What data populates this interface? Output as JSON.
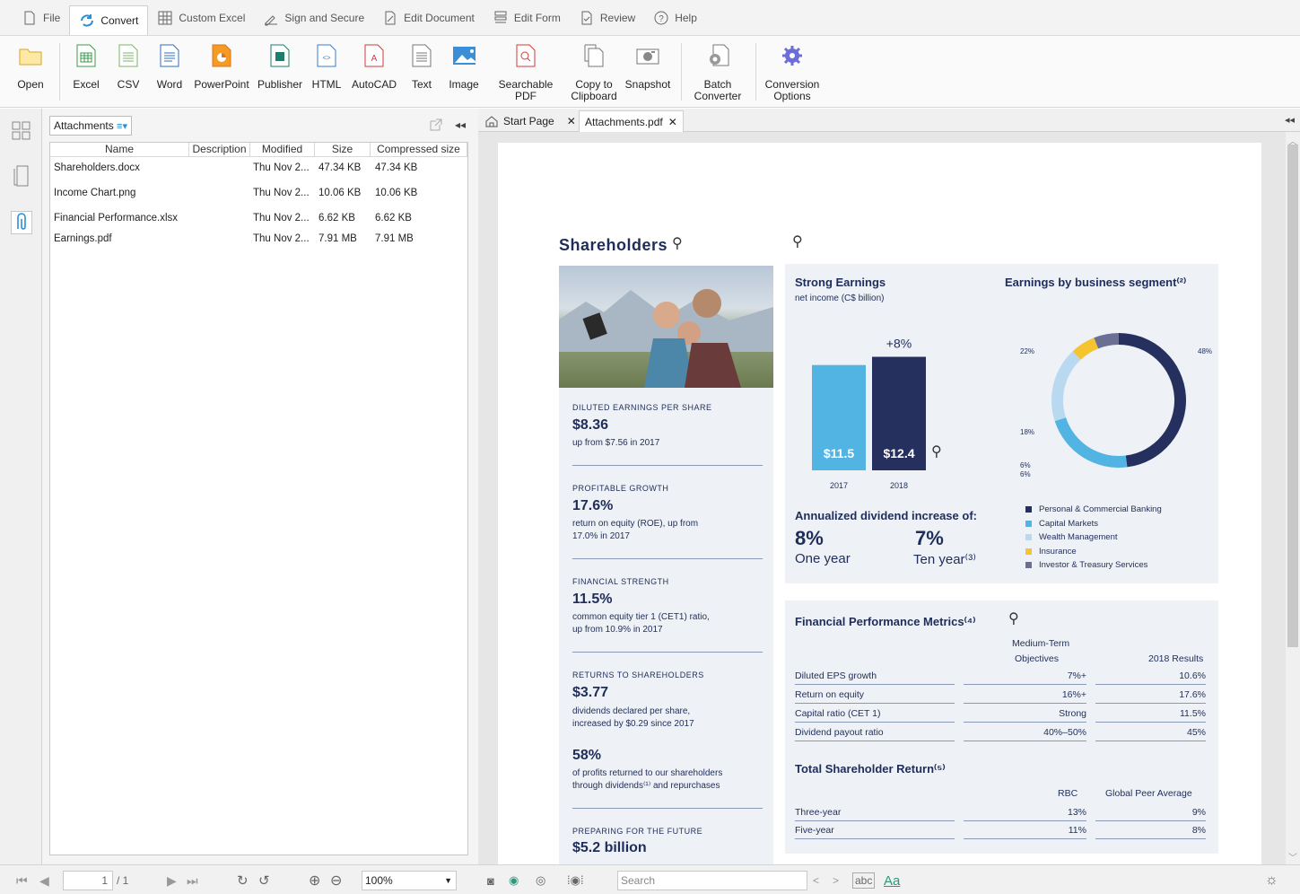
{
  "menubar": {
    "items": [
      {
        "label": "File",
        "icon": "file-icon"
      },
      {
        "label": "Convert",
        "icon": "convert-icon",
        "active": true
      },
      {
        "label": "Custom Excel",
        "icon": "table-icon"
      },
      {
        "label": "Sign and Secure",
        "icon": "sign-icon"
      },
      {
        "label": "Edit Document",
        "icon": "edit-icon"
      },
      {
        "label": "Edit Form",
        "icon": "form-icon"
      },
      {
        "label": "Review",
        "icon": "review-icon"
      },
      {
        "label": "Help",
        "icon": "help-icon"
      }
    ]
  },
  "ribbon": {
    "open": "Open",
    "excel": "Excel",
    "csv": "CSV",
    "word": "Word",
    "powerpoint": "PowerPoint",
    "publisher": "Publisher",
    "html": "HTML",
    "autocad": "AutoCAD",
    "text": "Text",
    "image": "Image",
    "searchable": "Searchable PDF",
    "copy1": "Copy to",
    "copy2": "Clipboard",
    "snapshot": "Snapshot",
    "batch1": "Batch",
    "batch2": "Converter",
    "conv1": "Conversion",
    "conv2": "Options"
  },
  "attachments": {
    "dropdown": "Attachments",
    "columns": [
      "Name",
      "Description",
      "Modified",
      "Size",
      "Compressed size"
    ],
    "rows": [
      {
        "name": "Shareholders.docx",
        "desc": "",
        "modified": "Thu Nov 2...",
        "size": "47.34 KB",
        "csize": "47.34 KB"
      },
      {
        "name": "Income Chart.png",
        "desc": "",
        "modified": "Thu Nov 2...",
        "size": "10.06 KB",
        "csize": "10.06 KB"
      },
      {
        "name": "Financial Performance.xlsx",
        "desc": "",
        "modified": "Thu Nov 2...",
        "size": "6.62 KB",
        "csize": "6.62 KB"
      },
      {
        "name": "Earnings.pdf",
        "desc": "",
        "modified": "Thu Nov 2...",
        "size": "7.91 MB",
        "csize": "7.91 MB"
      }
    ]
  },
  "tabs": {
    "start": "Start Page",
    "doc": "Attachments.pdf"
  },
  "doc": {
    "title": "Shareholders",
    "metrics": [
      {
        "label": "DILUTED EARNINGS PER SHARE",
        "value": "$8.36",
        "desc1": "up from $7.56 in 2017",
        "desc2": ""
      },
      {
        "label": "PROFITABLE GROWTH",
        "value": "17.6%",
        "desc1": "return on equity (ROE), up from",
        "desc2": "17.0% in 2017"
      },
      {
        "label": "FINANCIAL STRENGTH",
        "value": "11.5%",
        "desc1": "common equity tier 1 (CET1) ratio,",
        "desc2": "up from 10.9% in 2017"
      },
      {
        "label": "RETURNS TO SHAREHOLDERS",
        "value": "$3.77",
        "desc1": "dividends declared per share,",
        "desc2": "increased by $0.29 since 2017"
      },
      {
        "label": "",
        "value": "58%",
        "desc1": "of profits returned to our shareholders",
        "desc2": "through dividends⁽¹⁾ and repurchases"
      },
      {
        "label": "PREPARING FOR THE FUTURE",
        "value": "$5.2 billion",
        "desc1": "",
        "desc2": ""
      }
    ],
    "earnings_title": "Strong Earnings",
    "earnings_sub": "net income (C$ billion)",
    "segment_title": "Earnings by business segment⁽²⁾",
    "dividend_title": "Annualized dividend increase of:",
    "div_one_val": "8%",
    "div_one_lbl": "One year",
    "div_ten_val": "7%",
    "div_ten_lbl": "Ten year⁽³⁾",
    "fpm_title": "Financial Performance Metrics⁽⁴⁾",
    "fpm_head1a": "Medium-Term",
    "fpm_head1b": "Objectives",
    "fpm_head2": "2018 Results",
    "fpm_rows": [
      {
        "name": "Diluted EPS growth",
        "obj": "7%+",
        "res": "10.6%"
      },
      {
        "name": "Return on equity",
        "obj": "16%+",
        "res": "17.6%"
      },
      {
        "name": "Capital ratio (CET 1)",
        "obj": "Strong",
        "res": "11.5%"
      },
      {
        "name": "Dividend payout ratio",
        "obj": "40%–50%",
        "res": "45%"
      }
    ],
    "tsr_title": "Total Shareholder Return⁽⁵⁾",
    "tsr_head1": "RBC",
    "tsr_head2": "Global Peer Average",
    "tsr_rows": [
      {
        "name": "Three-year",
        "rbc": "13%",
        "peer": "9%"
      },
      {
        "name": "Five-year",
        "rbc": "11%",
        "peer": "8%"
      }
    ]
  },
  "chart_data": [
    {
      "type": "bar",
      "categories": [
        "2017",
        "2018"
      ],
      "values": [
        11.5,
        12.4
      ],
      "value_labels": [
        "$11.5",
        "$12.4"
      ],
      "annotation": "+8%",
      "colors": [
        "#52b4e3",
        "#26305f"
      ]
    },
    {
      "type": "pie",
      "labels": [
        "Personal & Commercial Banking",
        "Capital Markets",
        "Wealth Management",
        "Insurance",
        "Investor & Treasury Services"
      ],
      "values": [
        48,
        22,
        18,
        6,
        6
      ],
      "value_labels": [
        "48%",
        "22%",
        "18%",
        "6%",
        "6%"
      ],
      "colors": [
        "#26305f",
        "#52b4e3",
        "#b8d9f0",
        "#f5c431",
        "#6b6f93"
      ],
      "legend": "bottom"
    }
  ],
  "status": {
    "page": "1",
    "total": "/ 1",
    "zoom": "100%",
    "search_placeholder": "Search"
  }
}
